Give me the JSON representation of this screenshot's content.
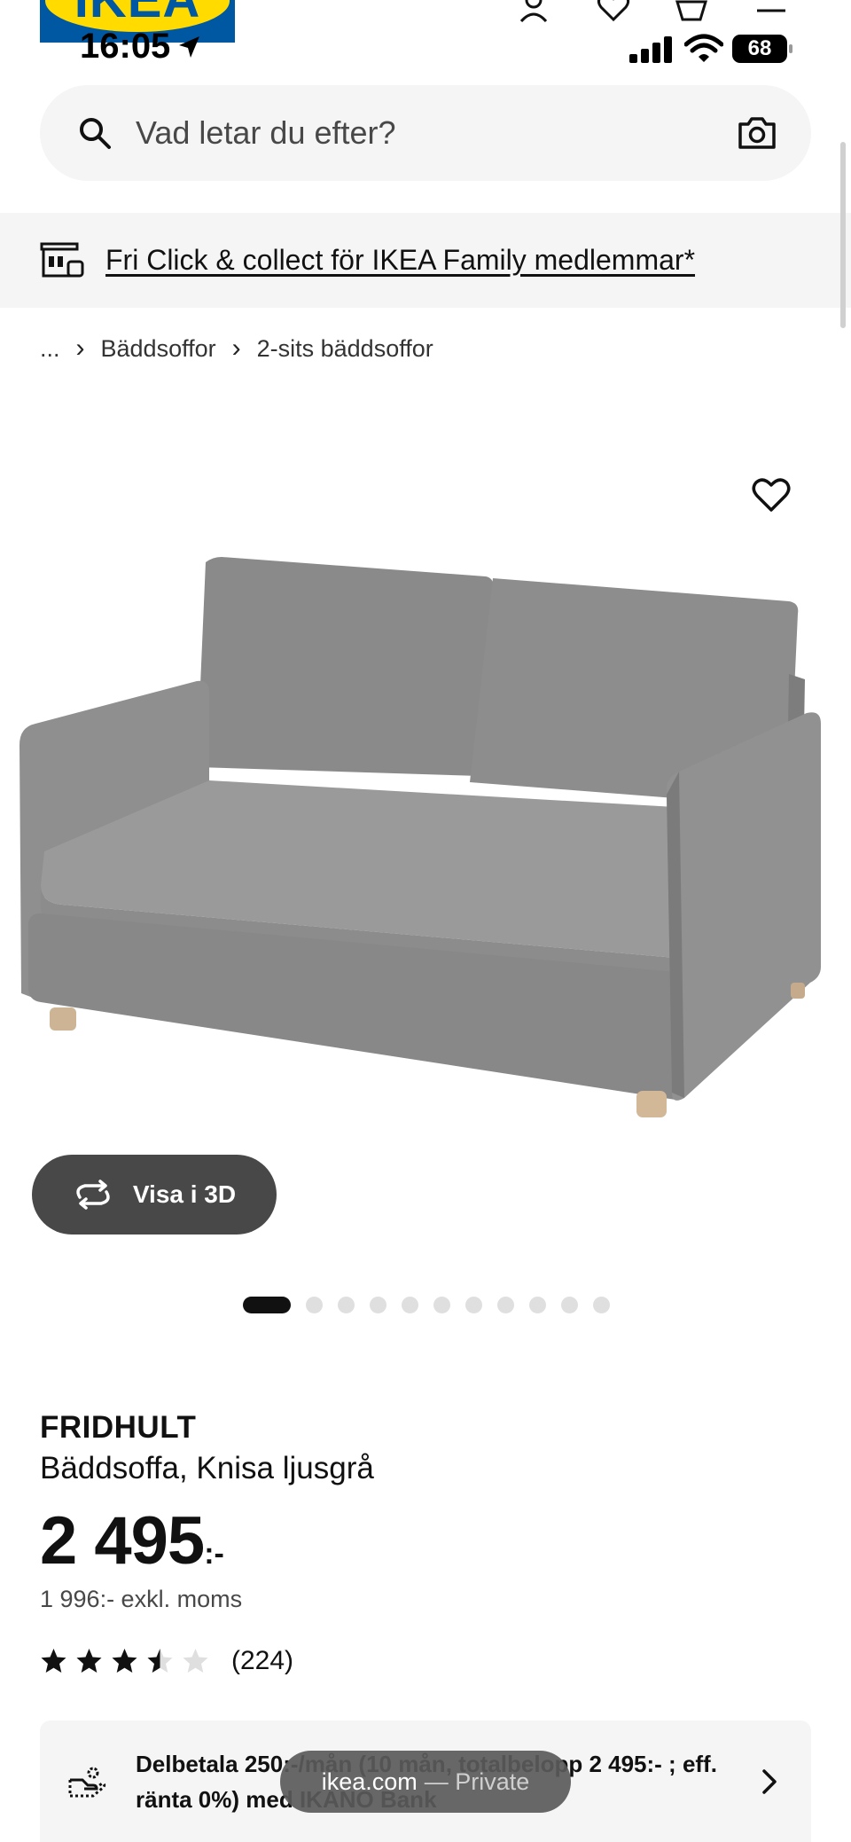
{
  "status_bar": {
    "time": "16:05",
    "battery": "68"
  },
  "header": {
    "logo_text": "IKEA",
    "icons": [
      "user-icon",
      "heart-icon",
      "basket-icon",
      "menu-icon"
    ]
  },
  "search": {
    "placeholder": "Vad letar du efter?"
  },
  "banner": {
    "text": "Fri Click & collect för IKEA Family medlemmar*"
  },
  "breadcrumb": {
    "ellipsis": "...",
    "items": [
      "Bäddsoffor",
      "2-sits bäddsoffor"
    ]
  },
  "gallery": {
    "view_3d_label": "Visa i 3D",
    "image_count": 11,
    "active_index": 0
  },
  "product": {
    "name": "FRIDHULT",
    "description": "Bäddsoffa, Knisa ljusgrå",
    "price": "2 495",
    "price_suffix": ":-",
    "price_ex_vat": "1 996:- exkl. moms",
    "rating": 3.5,
    "rating_max": 5,
    "review_count": "(224)"
  },
  "financing": {
    "text": "Delbetala 250:-/mån (10 mån, totalbelopp 2 495:- ; eff. ränta 0%) med IKANO Bank"
  },
  "browser": {
    "domain": "ikea.com",
    "mode": "— Private"
  },
  "colors": {
    "ikea_blue": "#0058a3",
    "ikea_yellow": "#ffdb00",
    "button_dark": "#484848",
    "panel_grey": "#f5f5f5",
    "sofa_grey": "#8e8e8e"
  }
}
